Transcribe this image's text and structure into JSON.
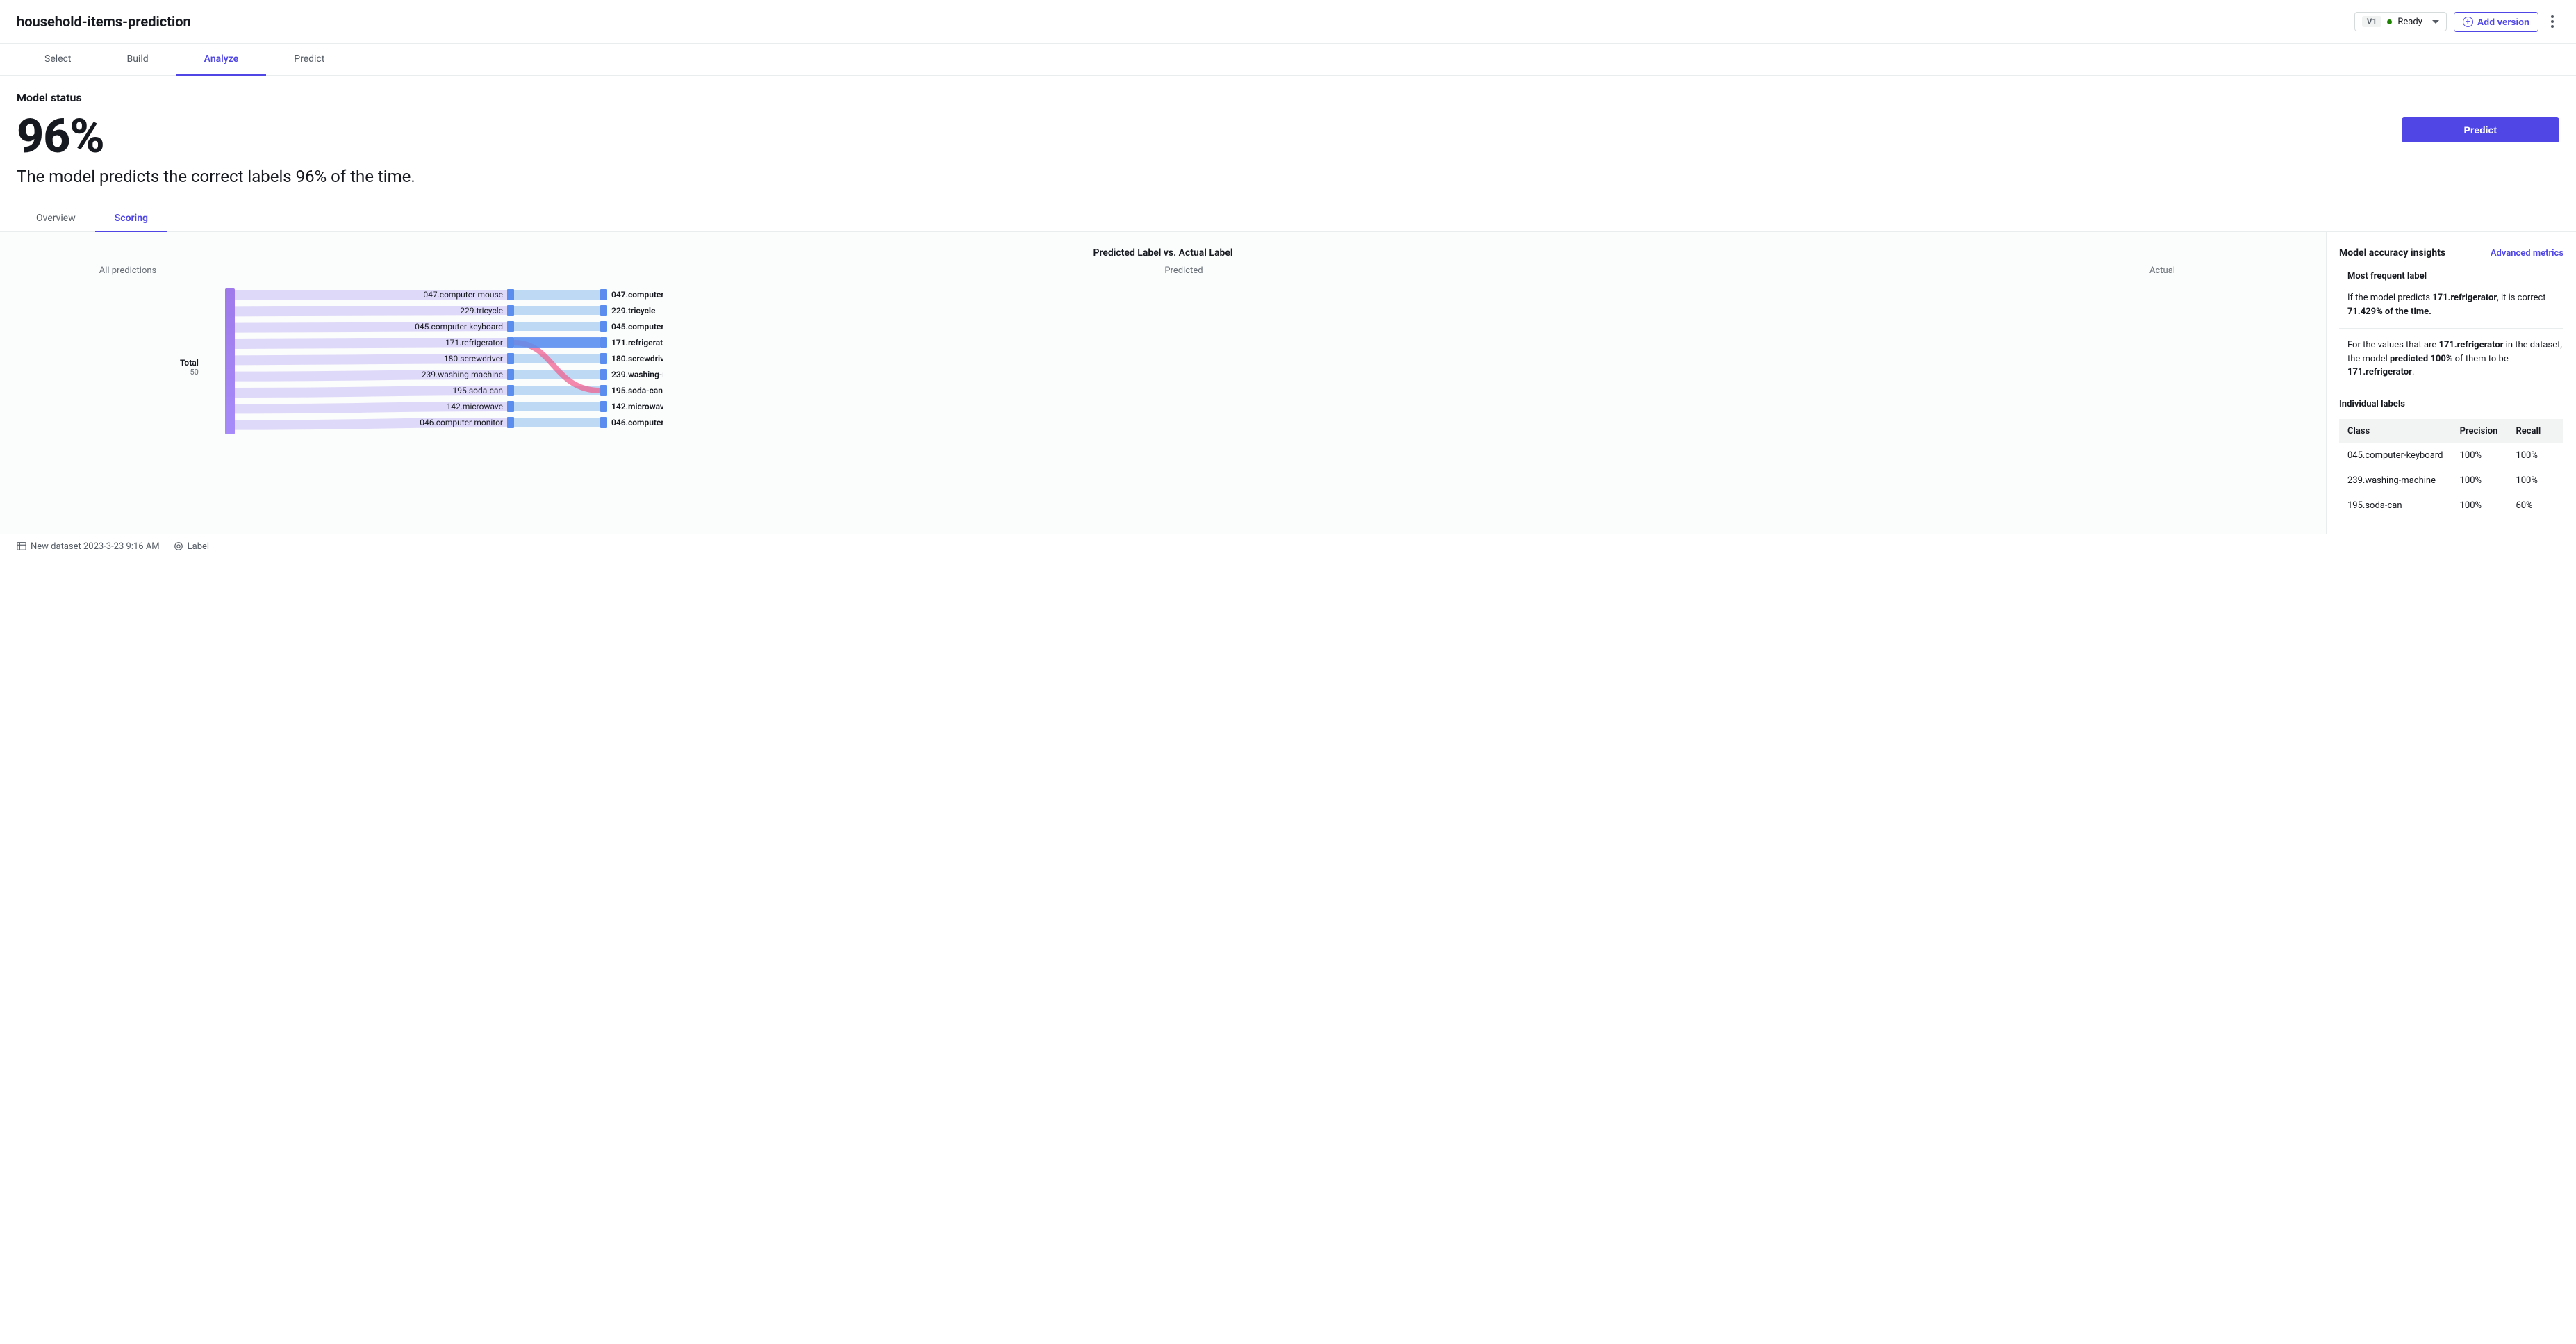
{
  "header": {
    "title": "household-items-prediction",
    "version_tag": "V1",
    "version_status": "Ready",
    "add_version_label": "Add version"
  },
  "nav": {
    "tabs": [
      "Select",
      "Build",
      "Analyze",
      "Predict"
    ],
    "active": "Analyze"
  },
  "status": {
    "label": "Model status",
    "percent": "96%",
    "description": "The model predicts the correct labels 96% of the time.",
    "predict_button": "Predict"
  },
  "subtabs": {
    "tabs": [
      "Overview",
      "Scoring"
    ],
    "active": "Scoring"
  },
  "chart": {
    "title": "Predicted Label vs. Actual Label",
    "col_all": "All predictions",
    "col_pred": "Predicted",
    "col_act": "Actual",
    "total_label": "Total",
    "total_count": "50"
  },
  "chart_data": {
    "type": "sankey",
    "total": 50,
    "predicted_labels": [
      "047.computer-mouse",
      "229.tricycle",
      "045.computer-keyboard",
      "171.refrigerator",
      "180.screwdriver",
      "239.washing-machine",
      "195.soda-can",
      "142.microwave",
      "046.computer-monitor"
    ],
    "actual_labels": [
      "047.computer-",
      "229.tricycle",
      "045.computer-",
      "171.refrigerat",
      "180.screwdriv",
      "239.washing-m",
      "195.soda-can",
      "142.microwav",
      "046.computer-"
    ],
    "flows": [
      {
        "from": "047.computer-mouse",
        "to": "047.computer-mouse",
        "correct": true
      },
      {
        "from": "229.tricycle",
        "to": "229.tricycle",
        "correct": true
      },
      {
        "from": "045.computer-keyboard",
        "to": "045.computer-keyboard",
        "correct": true
      },
      {
        "from": "171.refrigerator",
        "to": "171.refrigerator",
        "correct": true
      },
      {
        "from": "171.refrigerator",
        "to": "195.soda-can",
        "correct": false
      },
      {
        "from": "180.screwdriver",
        "to": "180.screwdriver",
        "correct": true
      },
      {
        "from": "239.washing-machine",
        "to": "239.washing-machine",
        "correct": true
      },
      {
        "from": "195.soda-can",
        "to": "195.soda-can",
        "correct": true
      },
      {
        "from": "142.microwave",
        "to": "142.microwave",
        "correct": true
      },
      {
        "from": "046.computer-monitor",
        "to": "046.computer-monitor",
        "correct": true
      }
    ]
  },
  "insights": {
    "title": "Model accuracy insights",
    "advanced_link": "Advanced metrics",
    "most_frequent_header": "Most frequent label",
    "para1_pre": "If the model predicts ",
    "para1_label": "171.refrigerator",
    "para1_mid": ", it is correct ",
    "para1_pct": "71.429% of the time.",
    "para2_pre": "For the values that are ",
    "para2_label1": "171.refrigerator",
    "para2_mid": " in the dataset, the model ",
    "para2_word": "predicted 100%",
    "para2_post": " of them to be ",
    "para2_label2": "171.refrigerator",
    "para2_end": ".",
    "individual_header": "Individual labels",
    "table": {
      "headers": {
        "class": "Class",
        "precision": "Precision",
        "recall": "Recall"
      },
      "rows": [
        {
          "class": "045.computer-keyboard",
          "precision": "100%",
          "recall": "100%"
        },
        {
          "class": "239.washing-machine",
          "precision": "100%",
          "recall": "100%"
        },
        {
          "class": "195.soda-can",
          "precision": "100%",
          "recall": "60%"
        }
      ]
    }
  },
  "footer": {
    "dataset": "New dataset 2023-3-23 9:16 AM",
    "label": "Label"
  }
}
